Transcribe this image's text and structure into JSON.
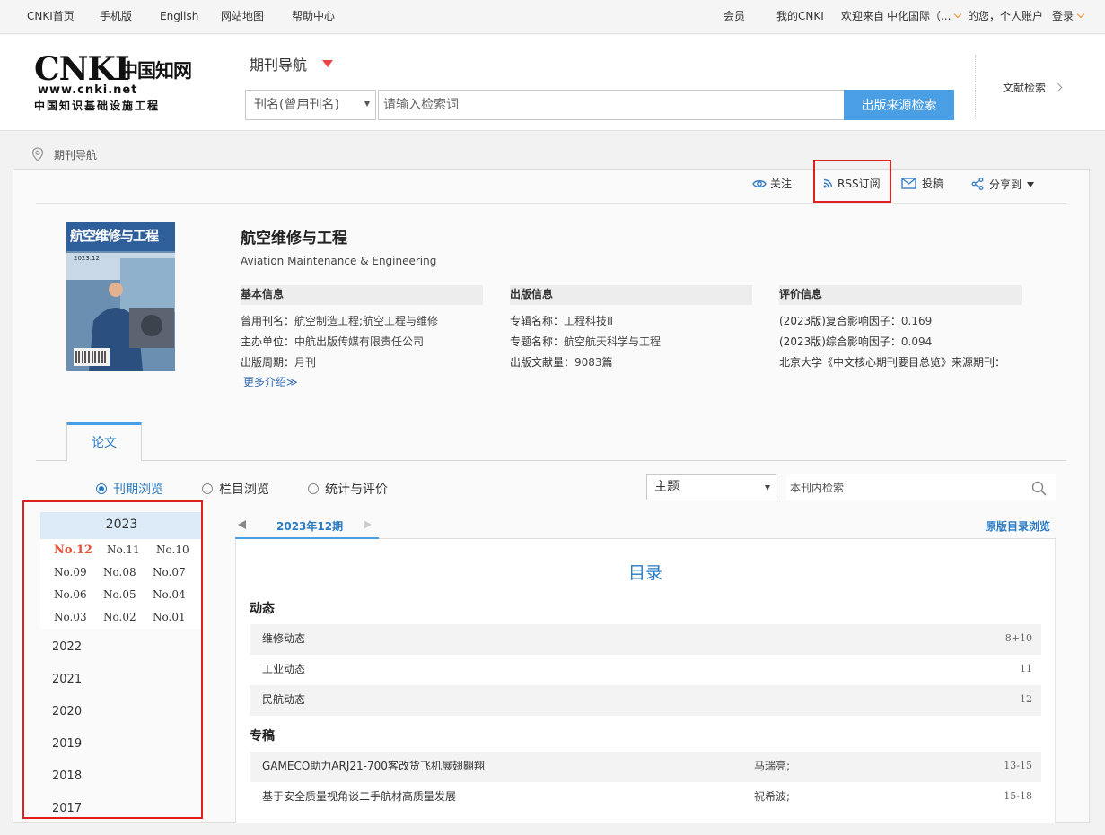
{
  "topbar": {
    "home": "CNKI首页",
    "mobile": "手机版",
    "english": "English",
    "sitemap": "网站地图",
    "help": "帮助中心",
    "member": "会员",
    "my_cnki": "我的CNKI",
    "welcome_prefix": "欢迎来自",
    "org_name": "中化国际（...",
    "welcome_suffix": "的您，个人账户",
    "login": "登录"
  },
  "header": {
    "logo_latin": "CNKI",
    "logo_cn": "中国知网",
    "logo_url": "www.cnki.net",
    "logo_sub": "中国知识基础设施工程",
    "nav_title": "期刊导航",
    "field_select": "刊名(曾用刊名)",
    "search_placeholder": "请输入检索词",
    "search_button": "出版来源检索",
    "literature_search": "文献检索"
  },
  "breadcrumb": "期刊导航",
  "actions": {
    "follow": "关注",
    "rss": "RSS订阅",
    "submit": "投稿",
    "share": "分享到"
  },
  "journal": {
    "cover_title": "航空维修与工程",
    "cover_year": "2023.12",
    "title": "航空维修与工程",
    "title_en": "Aviation Maintenance & Engineering",
    "basic": {
      "heading": "基本信息",
      "former_label": "曾用刊名：",
      "former_value": "航空制造工程;航空工程与维修",
      "sponsor_label": "主办单位：",
      "sponsor_value": "中航出版传媒有限责任公司",
      "period_label": "出版周期：",
      "period_value": "月刊",
      "more": "更多介绍≫"
    },
    "publish": {
      "heading": "出版信息",
      "series_label": "专辑名称：",
      "series_value": "工程科技II",
      "subject_label": "专题名称：",
      "subject_value": "航空航天科学与工程",
      "count_label": "出版文献量：",
      "count_value": "9083篇"
    },
    "eval": {
      "heading": "评价信息",
      "composite_label": "(2023版)复合影响因子：",
      "composite_value": "0.169",
      "overall_label": "(2023版)综合影响因子：",
      "overall_value": "0.094",
      "core_note": "北京大学《中文核心期刊要目总览》来源期刊："
    }
  },
  "tabs": {
    "paper": "论文"
  },
  "browse": {
    "issue_browse": "刊期浏览",
    "column_browse": "栏目浏览",
    "stats": "统计与评价",
    "topic_select": "主题",
    "in_journal_placeholder": "本刊内检索"
  },
  "years": {
    "current": "2023",
    "issues": [
      "No.12",
      "No.11",
      "No.10",
      "No.09",
      "No.08",
      "No.07",
      "No.06",
      "No.05",
      "No.04",
      "No.03",
      "No.02",
      "No.01"
    ],
    "others": [
      "2022",
      "2021",
      "2020",
      "2019",
      "2018",
      "2017"
    ]
  },
  "issue_nav": {
    "label": "2023年12期",
    "original_toc": "原版目录浏览"
  },
  "toc": {
    "title": "目录",
    "categories": [
      {
        "name": "动态",
        "rows": [
          {
            "title": "维修动态",
            "author": "",
            "pages": "8+10"
          },
          {
            "title": "工业动态",
            "author": "",
            "pages": "11"
          },
          {
            "title": "民航动态",
            "author": "",
            "pages": "12"
          }
        ]
      },
      {
        "name": "专稿",
        "rows": [
          {
            "title": "GAMECO助力ARJ21-700客改货飞机展翅翱翔",
            "author": "马瑞亮;",
            "pages": "13-15"
          },
          {
            "title": "基于安全质量视角谈二手航材高质量发展",
            "author": "祝希波;",
            "pages": "15-18"
          }
        ]
      }
    ]
  },
  "colors": {
    "accent_blue": "#4a9fe4",
    "link_blue": "#2a7bc4",
    "org_orange": "#f08a24",
    "highlight_red": "#e02020",
    "current_issue_red": "#e8503a"
  }
}
